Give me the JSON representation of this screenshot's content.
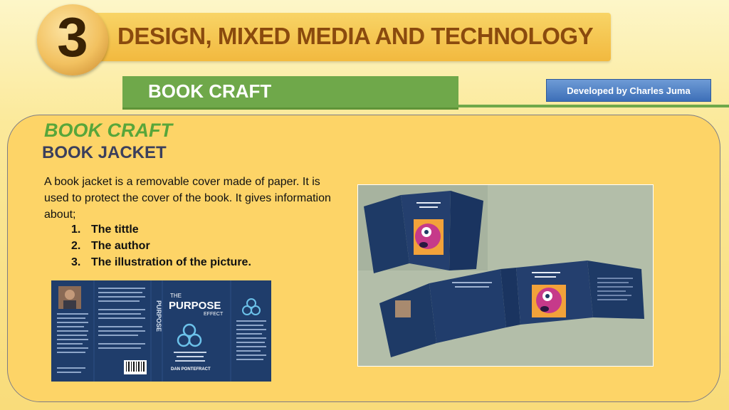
{
  "header": {
    "number": "3",
    "title": "DESIGN, MIXED MEDIA AND TECHNOLOGY",
    "subtitle": "BOOK CRAFT",
    "developer_button": "Developed by Charles Juma"
  },
  "content": {
    "heading": "BOOK CRAFT",
    "subheading": "BOOK JACKET",
    "paragraph": "A book jacket is a removable cover made of paper. It is used to protect the cover of the book. It gives information about;",
    "list": [
      {
        "num": "1.",
        "text": "The tittle"
      },
      {
        "num": "2.",
        "text": "The author"
      },
      {
        "num": "3.",
        "text": "The illustration of the picture."
      }
    ]
  },
  "images": {
    "left_book": {
      "title_line1": "THE",
      "title_line2": "PURPOSE",
      "title_line3": "EFFECT",
      "spine": "PURPOSE",
      "author": "DAN PONTEFRACT"
    }
  },
  "colors": {
    "title_text": "#8a4a0e",
    "subtitle_bar": "#6fa84a",
    "panel": "#fdd467",
    "heading_green": "#58a63a",
    "book_blue": "#1f3d6b",
    "button_blue": "#3d6fb8"
  }
}
